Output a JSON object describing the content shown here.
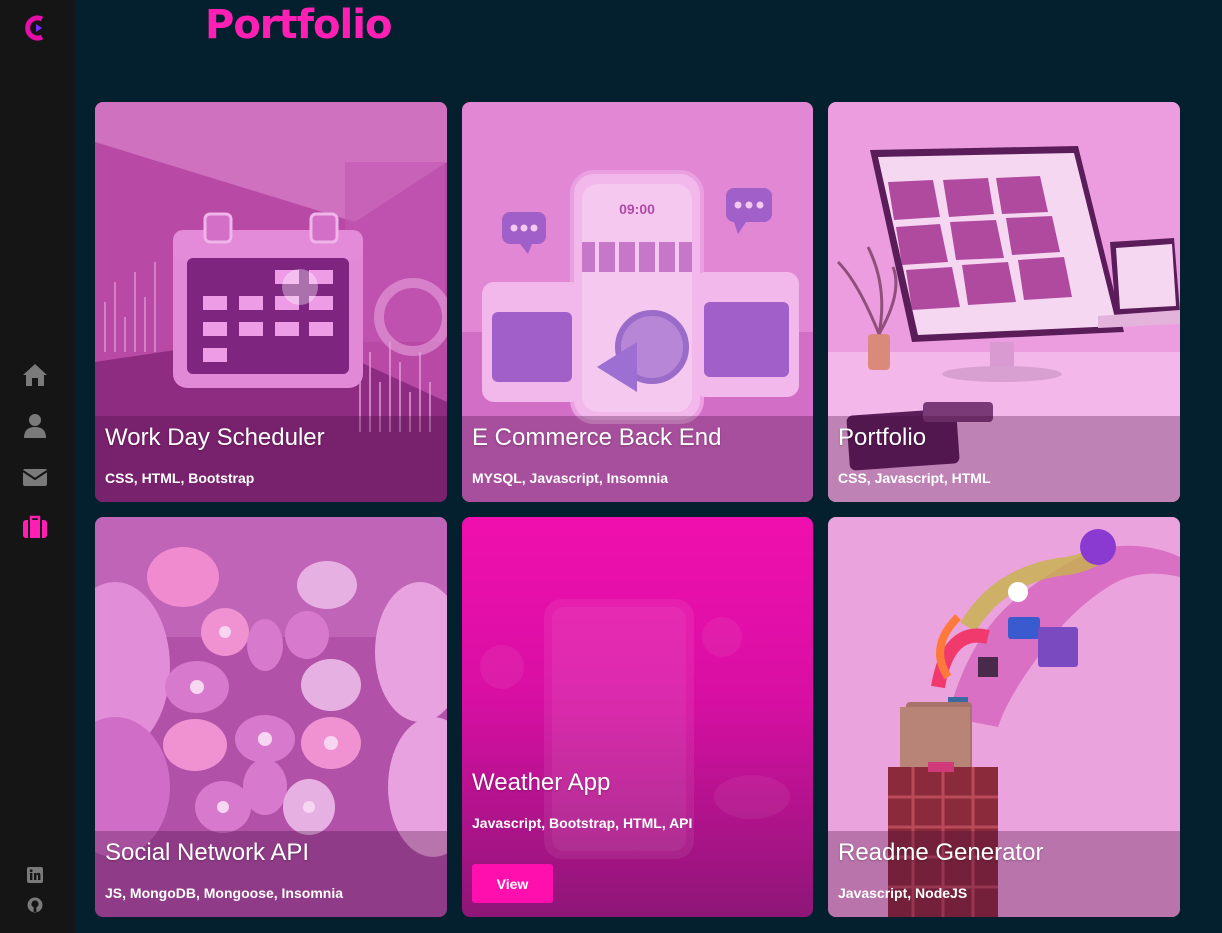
{
  "page": {
    "title": "Portfolio"
  },
  "colors": {
    "accent": "#ff1fb4",
    "background": "#04202e",
    "sidebar": "#151515",
    "icon": "#7a7a7a"
  },
  "sidebar": {
    "logo": "logo-c-icon",
    "nav": [
      {
        "icon": "home-icon"
      },
      {
        "icon": "user-icon"
      },
      {
        "icon": "envelope-icon"
      },
      {
        "icon": "briefcase-icon",
        "active": true
      }
    ],
    "social": [
      {
        "icon": "linkedin-icon"
      },
      {
        "icon": "github-icon"
      }
    ]
  },
  "projects": [
    {
      "title": "Work Day Scheduler",
      "tags": "CSS, HTML, Bootstrap"
    },
    {
      "title": "E Commerce Back End",
      "tags": "MYSQL, Javascript, Insomnia"
    },
    {
      "title": "Portfolio",
      "tags": "CSS, Javascript, HTML"
    },
    {
      "title": "Social Network API",
      "tags": "JS, MongoDB, Mongoose, Insomnia"
    },
    {
      "title": "Weather App",
      "tags": "Javascript, Bootstrap, HTML, API",
      "button": "View"
    },
    {
      "title": "Readme Generator",
      "tags": "Javascript, NodeJS"
    }
  ]
}
